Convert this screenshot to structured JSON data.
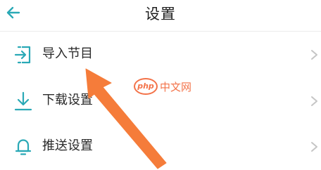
{
  "header": {
    "title": "设置",
    "back_icon": "back-arrow-icon"
  },
  "settings": {
    "items": [
      {
        "label": "导入节目",
        "icon": "import-icon"
      },
      {
        "label": "下载设置",
        "icon": "download-icon"
      },
      {
        "label": "推送设置",
        "icon": "bell-icon"
      }
    ],
    "chevron_icon": "chevron-right-icon"
  },
  "watermark": {
    "logo_text": "php",
    "site_text": "中文网"
  },
  "colors": {
    "accent": "#2aa9b6",
    "annotation_arrow": "#f57c3a",
    "watermark": "#f25a29",
    "chevron": "#c5c5c5"
  }
}
